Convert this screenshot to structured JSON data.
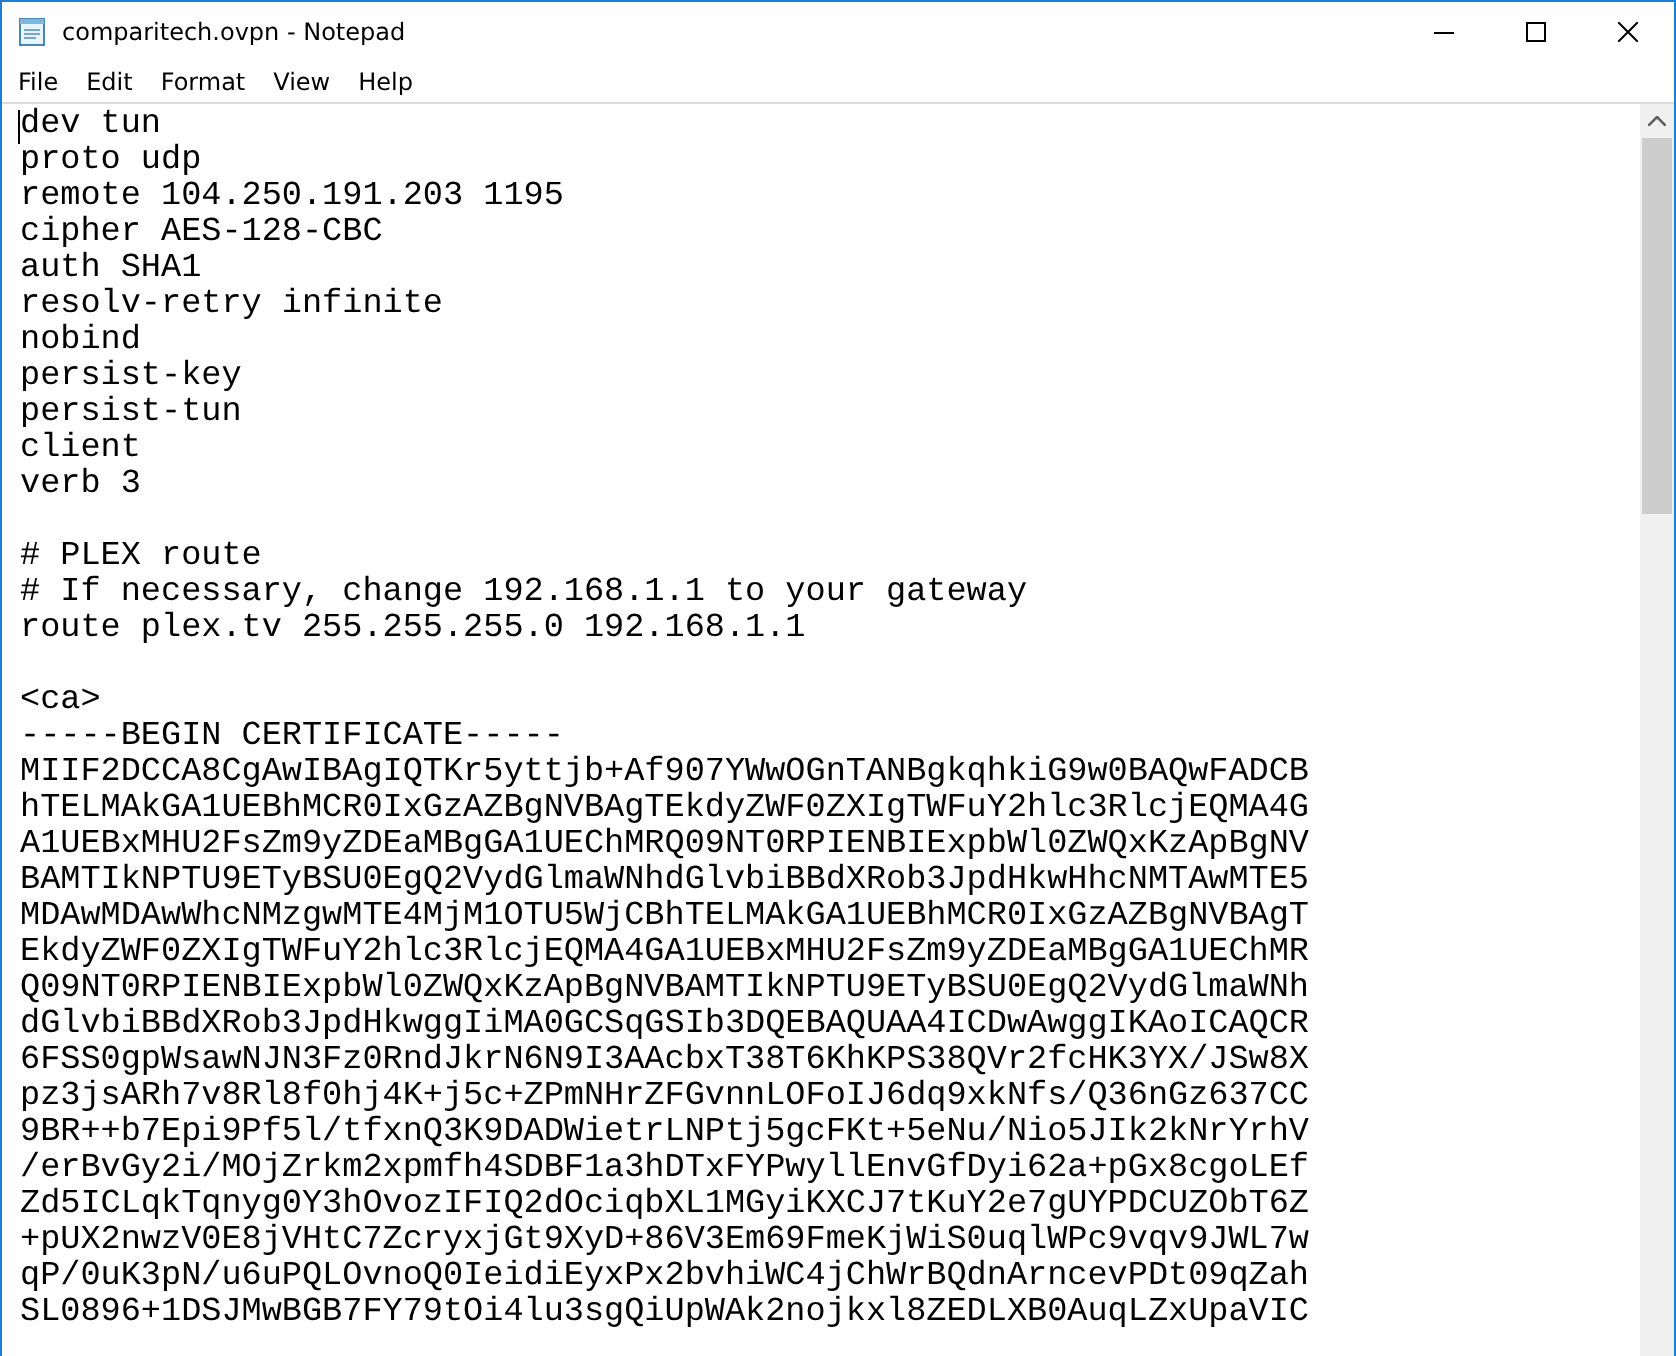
{
  "window": {
    "title": "comparitech.ovpn - Notepad"
  },
  "menu": [
    "File",
    "Edit",
    "Format",
    "View",
    "Help"
  ],
  "editor": {
    "text": "dev tun\nproto udp\nremote 104.250.191.203 1195\ncipher AES-128-CBC\nauth SHA1\nresolv-retry infinite\nnobind\npersist-key\npersist-tun\nclient\nverb 3\n\n# PLEX route\n# If necessary, change 192.168.1.1 to your gateway\nroute plex.tv 255.255.255.0 192.168.1.1\n\n<ca>\n-----BEGIN CERTIFICATE-----\nMIIF2DCCA8CgAwIBAgIQTKr5yttjb+Af907YWwOGnTANBgkqhkiG9w0BAQwFADCB\nhTELMAkGA1UEBhMCR0IxGzAZBgNVBAgTEkdyZWF0ZXIgTWFuY2hlc3RlcjEQMA4G\nA1UEBxMHU2FsZm9yZDEaMBgGA1UEChMRQ09NT0RPIENBIExpbWl0ZWQxKzApBgNV\nBAMTIkNPTU9ETyBSU0EgQ2VydGlmaWNhdGlvbiBBdXRob3JpdHkwHhcNMTAwMTE5\nMDAwMDAwWhcNMzgwMTE4MjM1OTU5WjCBhTELMAkGA1UEBhMCR0IxGzAZBgNVBAgT\nEkdyZWF0ZXIgTWFuY2hlc3RlcjEQMA4GA1UEBxMHU2FsZm9yZDEaMBgGA1UEChMR\nQ09NT0RPIENBIExpbWl0ZWQxKzApBgNVBAMTIkNPTU9ETyBSU0EgQ2VydGlmaWNh\ndGlvbiBBdXRob3JpdHkwggIiMA0GCSqGSIb3DQEBAQUAA4ICDwAwggIKAoICAQCR\n6FSS0gpWsawNJN3Fz0RndJkrN6N9I3AAcbxT38T6KhKPS38QVr2fcHK3YX/JSw8X\npz3jsARh7v8Rl8f0hj4K+j5c+ZPmNHrZFGvnnLOFoIJ6dq9xkNfs/Q36nGz637CC\n9BR++b7Epi9Pf5l/tfxnQ3K9DADWietrLNPtj5gcFKt+5eNu/Nio5JIk2kNrYrhV\n/erBvGy2i/MOjZrkm2xpmfh4SDBF1a3hDTxFYPwyllEnvGfDyi62a+pGx8cgoLEf\nZd5ICLqkTqnyg0Y3hOvozIFIQ2dOciqbXL1MGyiKXCJ7tKuY2e7gUYPDCUZObT6Z\n+pUX2nwzV0E8jVHtC7ZcryxjGt9XyD+86V3Em69FmeKjWiS0uqlWPc9vqv9JWL7w\nqP/0uK3pN/u6uPQLOvnoQ0IeidiEyxPx2bvhiWC4jChWrBQdnArncevPDt09qZah\nSL0896+1DSJMwBGB7FY79tOi4lu3sgQiUpWAk2nojkxl8ZEDLXB0AuqLZxUpaVIC"
  }
}
